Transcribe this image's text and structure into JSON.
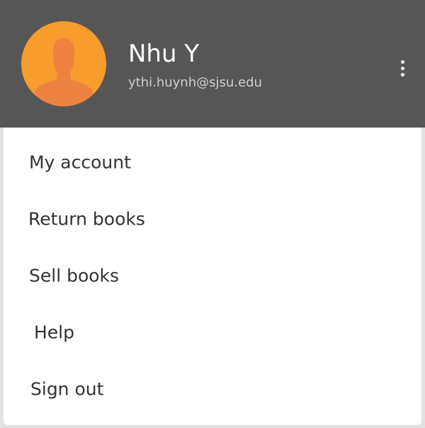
{
  "header": {
    "user_name": "Nhu Y",
    "user_email": "ythi.huynh@sjsu.edu",
    "avatar_icon": "person-silhouette-icon",
    "more_icon": "more-vertical-icon",
    "colors": {
      "header_background": "#565656",
      "avatar_background": "#f89c2b",
      "avatar_silhouette": "#ee8240"
    }
  },
  "menu": {
    "items": [
      {
        "label": "My account"
      },
      {
        "label": "Return books"
      },
      {
        "label": "Sell books"
      },
      {
        "label": "Help"
      },
      {
        "label": "Sign out"
      }
    ]
  }
}
